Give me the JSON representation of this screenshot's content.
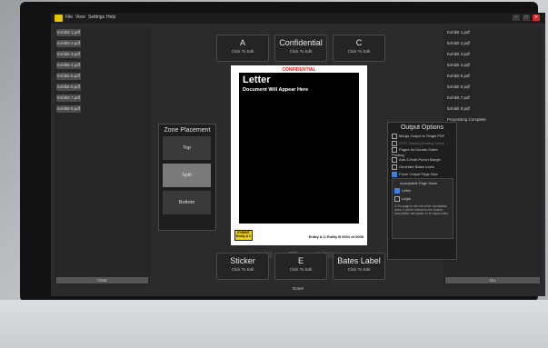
{
  "menu": {
    "items": [
      "File",
      "View",
      "Settings",
      "Help"
    ]
  },
  "window_buttons": [
    "–",
    "□",
    "✕"
  ],
  "exhibits": {
    "items": [
      "Exhibit 1.pdf",
      "Exhibit 2.pdf",
      "Exhibit 3.pdf",
      "Exhibit 4.pdf",
      "Exhibit 5.pdf",
      "Exhibit 6.pdf",
      "Exhibit 7.pdf",
      "Exhibit 8.pdf"
    ],
    "clear_label": "Clear"
  },
  "top_buttons": [
    {
      "label": "A",
      "sub": "Click To Edit"
    },
    {
      "label": "Confidential",
      "sub": "Click To Edit"
    },
    {
      "label": "C",
      "sub": "Click To Edit"
    }
  ],
  "bottom_buttons": [
    {
      "label": "Sticker",
      "sub": "Click To Edit"
    },
    {
      "label": "E",
      "sub": "Click To Edit"
    },
    {
      "label": "Bates Label",
      "sub": "Click To Edit"
    }
  ],
  "zone": {
    "title": "Zone Placement",
    "buttons": [
      "Top",
      "Split",
      "Bottom"
    ],
    "selected": "Split"
  },
  "preview": {
    "confidential": "CONFIDENTIAL",
    "page_title": "Letter",
    "page_subtitle": "Document Will Appear Here",
    "stamp_line1": "EXHIBIT",
    "stamp_line2": "Entity A 1",
    "bates": "Entity A 1/ Entity B 0001 of 0008"
  },
  "pager": {
    "prev": "←",
    "page": "1",
    "of": "of 8",
    "next": "→"
  },
  "output": {
    "title": "Output Options",
    "options": [
      {
        "label": "Merge Output to Single PDF",
        "checked": false
      },
      {
        "label": "OCR Output (Existing Scan)",
        "checked": false
      },
      {
        "label": "Pages for Double-Sided Printing",
        "checked": false
      },
      {
        "label": "Add 3-Hole-Punch Margin",
        "checked": false
      },
      {
        "label": "Generate Bates Index",
        "checked": false
      },
      {
        "label": "Force Output Page Size",
        "checked": true
      }
    ],
    "sizes_title": "Acceptable Page Sizes",
    "sizes": [
      {
        "label": "Letter",
        "checked": true
      },
      {
        "label": "Legal",
        "checked": false
      }
    ],
    "note": "⊙ If a page is not one of the acceptable sizes, it will be resized to the closest acceptable one based on its aspect ratio."
  },
  "files_out": {
    "items": [
      "Exhibit 1.pdf",
      "Exhibit 2.pdf",
      "Exhibit 3.pdf",
      "Exhibit 4.pdf",
      "Exhibit 5.pdf",
      "Exhibit 6.pdf",
      "Exhibit 7.pdf",
      "Exhibit 8.pdf",
      "Processing Complete"
    ],
    "go_label": "Go"
  },
  "status": "Done!",
  "colors": {
    "accent": "#3a7ef0",
    "stamp": "#f2d200",
    "close": "#d42b2b",
    "confidential": "#e02020"
  }
}
